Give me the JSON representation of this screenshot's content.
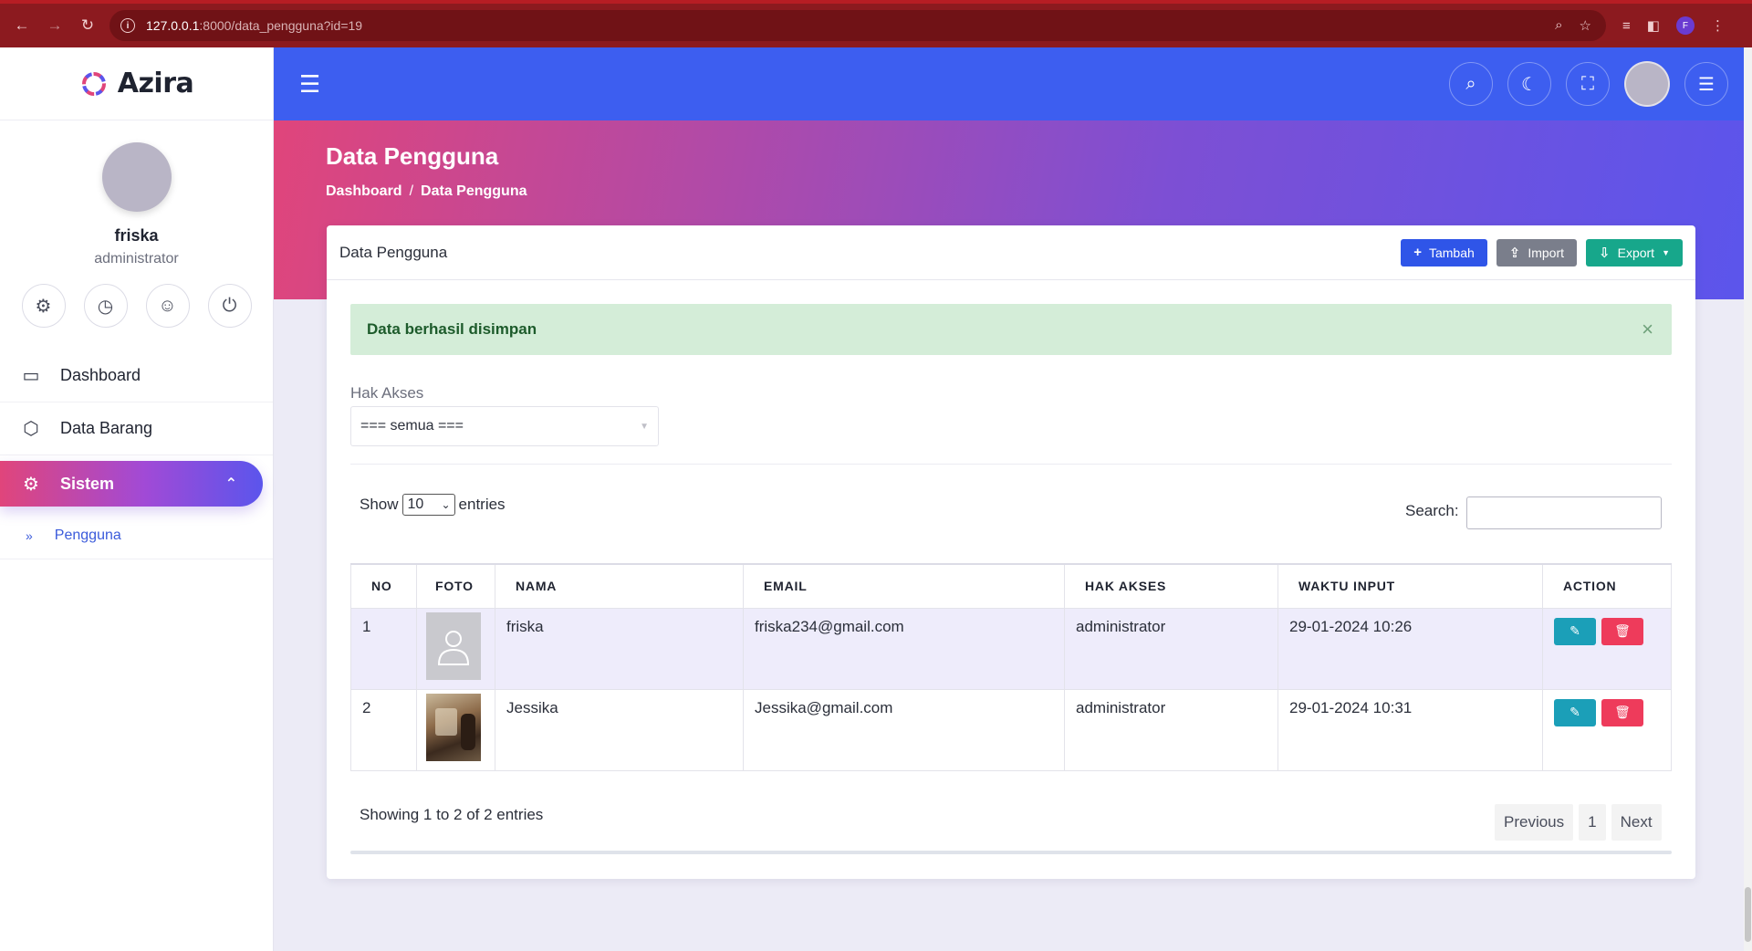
{
  "browser": {
    "url_host": "127.0.0.1",
    "url_path": ":8000/data_pengguna?id=19",
    "profile_initial": "F"
  },
  "sidebar": {
    "brand": "Azira",
    "user_name": "friska",
    "user_role": "administrator",
    "menu": [
      {
        "label": "Dashboard",
        "icon": "monitor-icon"
      },
      {
        "label": "Data Barang",
        "icon": "box-icon"
      },
      {
        "label": "Sistem",
        "icon": "gear-icon",
        "active": true
      }
    ],
    "submenu": [
      {
        "label": "Pengguna",
        "icon": "double-chevron-right-icon"
      }
    ]
  },
  "hero": {
    "title": "Data Pengguna",
    "breadcrumb_home": "Dashboard",
    "breadcrumb_sep": "/",
    "breadcrumb_current": "Data Pengguna"
  },
  "card": {
    "title": "Data Pengguna",
    "btn_add": "Tambah",
    "btn_import": "Import",
    "btn_export": "Export",
    "alert": "Data berhasil disimpan",
    "alert_close": "×",
    "filter_label": "Hak Akses",
    "filter_value": "=== semua ===",
    "show_prefix": "Show",
    "show_value": "10",
    "show_suffix": "entries",
    "search_label": "Search:",
    "columns": [
      "NO",
      "FOTO",
      "NAMA",
      "EMAIL",
      "HAK AKSES",
      "WAKTU INPUT",
      "ACTION"
    ],
    "rows": [
      {
        "no": "1",
        "nama": "friska",
        "email": "friska234@gmail.com",
        "hak_akses": "administrator",
        "waktu": "29-01-2024 10:26",
        "foto": "placeholder-user-icon"
      },
      {
        "no": "2",
        "nama": "Jessika",
        "email": "Jessika@gmail.com",
        "hak_akses": "administrator",
        "waktu": "29-01-2024 10:31",
        "foto": "user-photo"
      }
    ],
    "info": "Showing 1 to 2 of 2 entries",
    "pager": {
      "prev": "Previous",
      "page": "1",
      "next": "Next"
    }
  },
  "colors": {
    "topbar": "#3d5ef0",
    "accent_pink": "#e0457b",
    "accent_purple": "#5b55ec",
    "alert_bg": "#d4edd8"
  }
}
